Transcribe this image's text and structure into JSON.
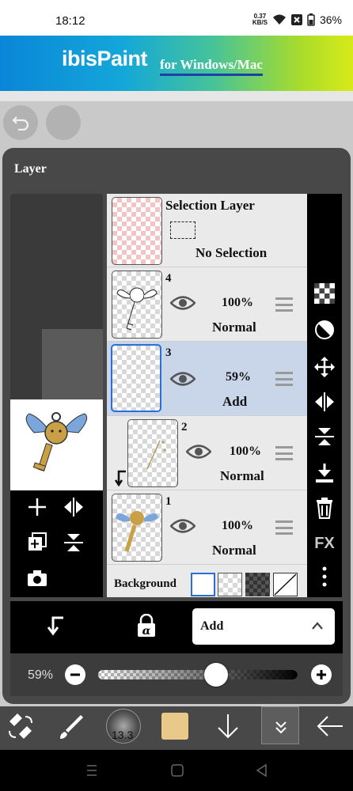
{
  "status_bar": {
    "time": "18:12",
    "net_speed_value": "0.37",
    "net_speed_unit": "KB/S",
    "battery": "36%"
  },
  "banner": {
    "logo": "ibisPaint",
    "subtitle": "for Windows/Mac"
  },
  "panel": {
    "title": "Layer"
  },
  "selection_layer": {
    "title": "Selection Layer",
    "status": "No Selection"
  },
  "layers": [
    {
      "number": "4",
      "opacity": "100%",
      "blend": "Normal"
    },
    {
      "number": "3",
      "opacity": "59%",
      "blend": "Add"
    },
    {
      "number": "2",
      "opacity": "100%",
      "blend": "Normal"
    },
    {
      "number": "1",
      "opacity": "100%",
      "blend": "Normal"
    }
  ],
  "background_row": {
    "label": "Background"
  },
  "right_toolbar": {
    "fx_label": "FX"
  },
  "blend_mode": {
    "selected": "Add"
  },
  "opacity_slider": {
    "value_label": "59%",
    "value": 0.59
  },
  "bottom_toolbar": {
    "brush_size": "13.3",
    "color": "#e8c98a"
  },
  "colors": {
    "accent": "#2a6ed6",
    "selected_row": "#c9d6ea",
    "panel": "#484848"
  }
}
